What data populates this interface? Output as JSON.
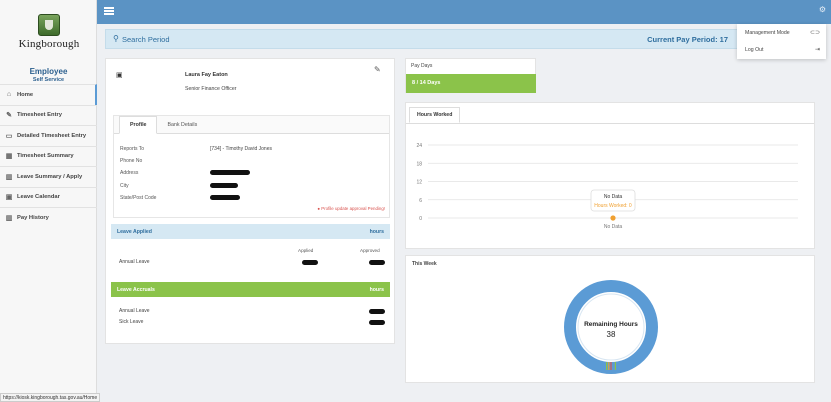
{
  "brand": {
    "name": "Kingborough",
    "app_title": "Employee",
    "app_subtitle": "Self Service"
  },
  "sidebar": {
    "items": [
      {
        "label": "Home",
        "icon": "home-icon",
        "glyph": "⌂"
      },
      {
        "label": "Timesheet Entry",
        "icon": "edit-icon",
        "glyph": "✎"
      },
      {
        "label": "Detailed Timesheet Entry",
        "icon": "monitor-icon",
        "glyph": "▭"
      },
      {
        "label": "Timesheet Summary",
        "icon": "table-icon",
        "glyph": "▦"
      },
      {
        "label": "Leave Summary / Apply",
        "icon": "bar-chart-icon",
        "glyph": "▥"
      },
      {
        "label": "Leave Calendar",
        "icon": "calendar-icon",
        "glyph": "▣"
      },
      {
        "label": "Pay History",
        "icon": "bar-chart-icon",
        "glyph": "▥"
      }
    ]
  },
  "search": {
    "label": "Search Period",
    "current_pay_period": "Current Pay Period: 17"
  },
  "menu": {
    "management_mode": "Management Mode",
    "log_out": "Log Out"
  },
  "profile": {
    "name": "Laura Fay Eaton",
    "role": "Senior Finance Officer",
    "tabs": [
      "Profile",
      "Bank Details"
    ],
    "fields": [
      {
        "label": "Reports To",
        "value": "[734] - Timothy David Jones"
      },
      {
        "label": "Phone No",
        "value": ""
      },
      {
        "label": "Address",
        "value": ""
      },
      {
        "label": "City",
        "value": ""
      },
      {
        "label": "State/Post Code",
        "value": ""
      }
    ],
    "pending_notice": "Profile update approval Pending!"
  },
  "leave_applied": {
    "title": "Leave Applied",
    "unit": "hours",
    "col_applied": "Applied",
    "col_approved": "Approved",
    "rows": [
      {
        "label": "Annual Leave"
      }
    ]
  },
  "leave_accruals": {
    "title": "Leave Accruals",
    "unit": "hours",
    "rows": [
      {
        "label": "Annual Leave"
      },
      {
        "label": "Sick Leave"
      }
    ]
  },
  "pay_days": {
    "title": "Pay Days",
    "value": "8 / 14 Days"
  },
  "hours_worked": {
    "tab": "Hours Worked",
    "no_data_title": "No Data",
    "no_data_series": "Hours Worked: 0",
    "x_label": "No Data"
  },
  "this_week": {
    "title": "This Week",
    "center_label": "Remaining Hours",
    "center_value": "38"
  },
  "chart_data": [
    {
      "type": "line",
      "categories": [
        "No Data"
      ],
      "series": [
        {
          "name": "Hours Worked",
          "values": [
            0
          ]
        }
      ],
      "ylim": [
        0,
        24
      ],
      "yticks": [
        0,
        6,
        12,
        18,
        24
      ],
      "grid": true,
      "color": "#f0a030"
    },
    {
      "type": "pie",
      "labels": [
        "Remaining Hours"
      ],
      "values": [
        38
      ],
      "donut": true,
      "colors": [
        "#5b9bd5"
      ]
    }
  ],
  "status_url": "https://kiosk.kingborough.tas.gov.au/Home",
  "colors": {
    "topbar": "#5b93c4",
    "accent": "#2f6e9e",
    "green": "#8bc34a",
    "alert": "#d9534f"
  }
}
